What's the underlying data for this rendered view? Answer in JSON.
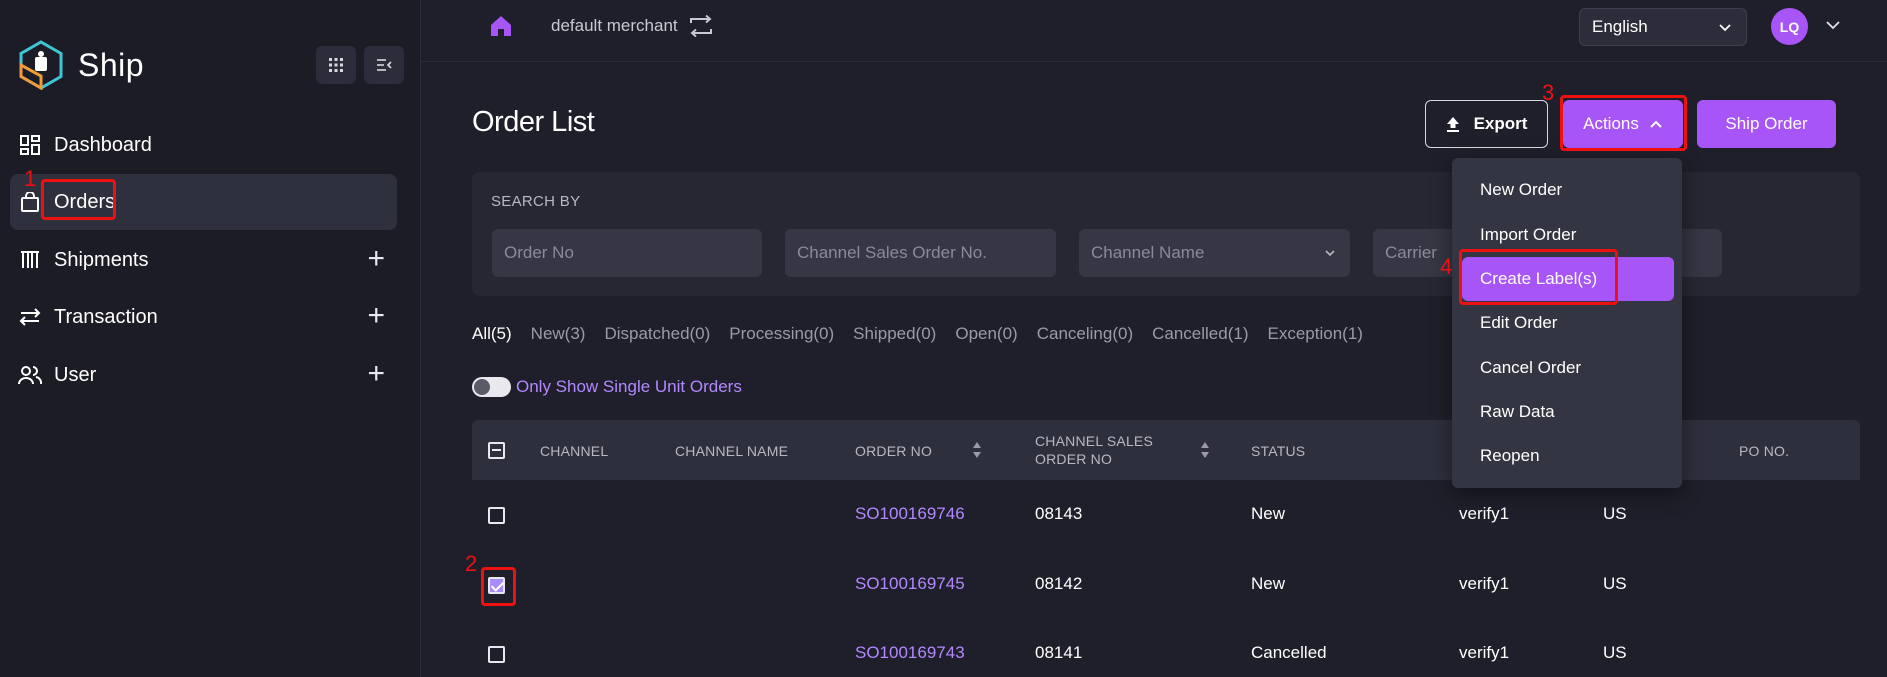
{
  "app": {
    "name": "Ship"
  },
  "sidebar": {
    "items": [
      {
        "label": "Dashboard",
        "icon": "dashboard-icon",
        "expandable": false
      },
      {
        "label": "Orders",
        "icon": "shopping-bag-icon",
        "expandable": false,
        "active": true
      },
      {
        "label": "Shipments",
        "icon": "warehouse-icon",
        "expandable": true
      },
      {
        "label": "Transaction",
        "icon": "transfer-icon",
        "expandable": true
      },
      {
        "label": "User",
        "icon": "users-icon",
        "expandable": true
      }
    ]
  },
  "topbar": {
    "merchant": "default merchant",
    "language": "English",
    "avatar_initials": "LQ"
  },
  "page": {
    "title": "Order List",
    "export_label": "Export",
    "actions_label": "Actions",
    "ship_order_label": "Ship Order"
  },
  "search": {
    "label": "SEARCH BY",
    "order_no_placeholder": "Order No",
    "channel_sales_placeholder": "Channel Sales Order No.",
    "channel_name_placeholder": "Channel Name",
    "carrier_placeholder": "Carrier"
  },
  "tabs": [
    "All(5)",
    "New(3)",
    "Dispatched(0)",
    "Processing(0)",
    "Shipped(0)",
    "Open(0)",
    "Canceling(0)",
    "Cancelled(1)",
    "Exception(1)"
  ],
  "toggle": {
    "label": "Only Show Single Unit Orders",
    "on": false
  },
  "table": {
    "headers": {
      "channel": "CHANNEL",
      "channel_name": "CHANNEL NAME",
      "order_no": "ORDER NO",
      "channel_sales_1": "CHANNEL SALES",
      "channel_sales_2": "ORDER NO",
      "status": "STATUS",
      "po_no": "PO NO."
    },
    "rows": [
      {
        "order_no": "SO100169746",
        "channel_sales": "08143",
        "status": "New",
        "col6": "verify1",
        "col7": "US",
        "checked": false
      },
      {
        "order_no": "SO100169745",
        "channel_sales": "08142",
        "status": "New",
        "col6": "verify1",
        "col7": "US",
        "checked": true
      },
      {
        "order_no": "SO100169743",
        "channel_sales": "08141",
        "status": "Cancelled",
        "col6": "verify1",
        "col7": "US",
        "checked": false
      }
    ]
  },
  "actions_menu": [
    "New Order",
    "Import Order",
    "Create Label(s)",
    "Edit Order",
    "Cancel Order",
    "Raw Data",
    "Reopen"
  ],
  "annotations": [
    "1",
    "2",
    "3",
    "4"
  ],
  "colors": {
    "accent": "#a855f7",
    "link": "#b388ff",
    "annotation": "#ee1111"
  }
}
